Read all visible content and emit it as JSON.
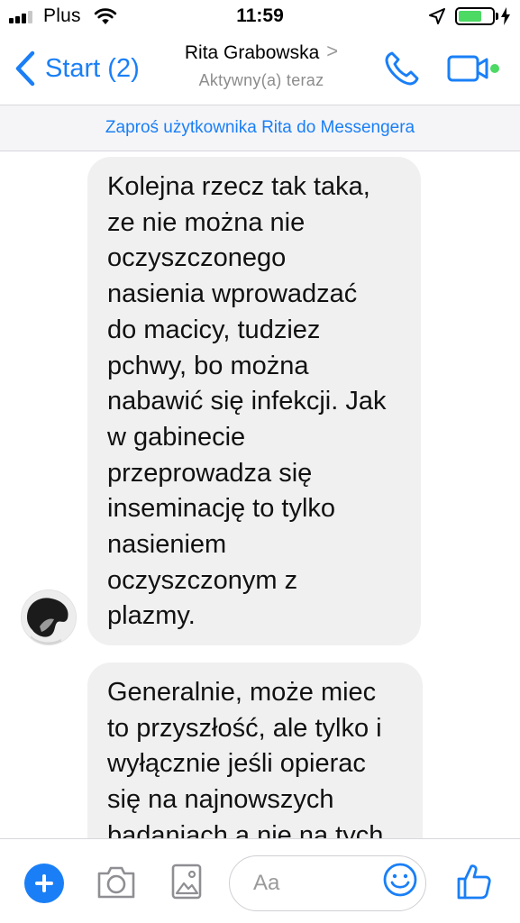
{
  "status_bar": {
    "carrier": "Plus",
    "time": "11:59",
    "battery_percent": 70
  },
  "header": {
    "back_label": "Start (2)",
    "contact_name": "Rita Grabowska",
    "contact_chevron": ">",
    "contact_status": "Aktywny(a) teraz"
  },
  "invite_banner": "Zaproś użytkownika Rita do Messengera",
  "messages": [
    {
      "text": "Kolejna rzecz tak taka,\nze nie można nie\noczyszczonego\nnasienia wprowadzać\ndo macicy, tudziez\npchwy, bo można\nnabawić się infekcji. Jak\nw gabinecie\nprzeprowadza się\ninseminację to tylko\nnasieniem\noczyszczonym z\nplazmy."
    },
    {
      "text": "Generalnie, może miec\nto przyszłość, ale tylko i\nwyłącznie jeśli opierac\nsię na najnowszych\nbadaniach a nie na tych"
    }
  ],
  "composer": {
    "placeholder": "Aa"
  },
  "colors": {
    "accent": "#1a7ff6",
    "bubble_bg": "#f1f0f0",
    "online_dot": "#4cd964"
  },
  "icons": [
    "signal-icon",
    "wifi-icon",
    "location-arrow-icon",
    "battery-icon",
    "charging-bolt-icon",
    "back-chevron-icon",
    "phone-icon",
    "video-camera-icon",
    "plus-icon",
    "camera-icon",
    "photo-gallery-icon",
    "emoji-icon",
    "thumbs-up-icon"
  ]
}
